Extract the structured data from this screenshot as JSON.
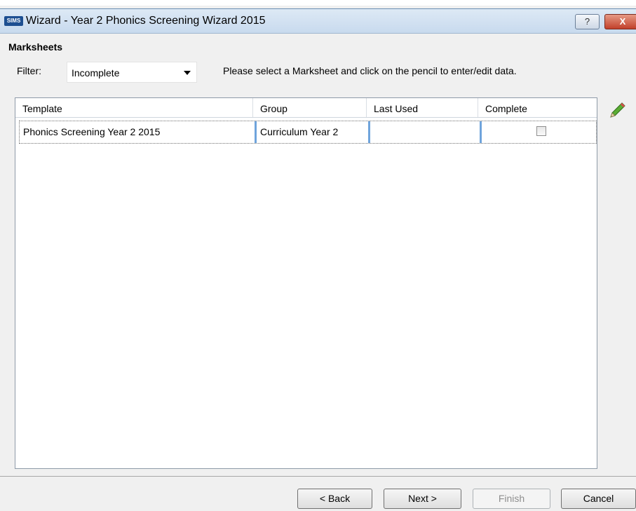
{
  "window": {
    "icon_text": "SIMS",
    "title": "Wizard - Year 2 Phonics Screening Wizard 2015",
    "help_label": "?",
    "close_label": "X"
  },
  "section_title": "Marksheets",
  "filter": {
    "label": "Filter:",
    "value": "Incomplete"
  },
  "instruction": "Please select a Marksheet and click on the pencil to enter/edit data.",
  "grid": {
    "columns": [
      "Template",
      "Group",
      "Last Used",
      "Complete"
    ],
    "rows": [
      {
        "template": "Phonics Screening Year 2 2015",
        "group": "Curriculum Year  2",
        "last_used": "",
        "complete": false
      }
    ]
  },
  "buttons": {
    "back": "< Back",
    "next": "Next >",
    "finish": "Finish",
    "cancel": "Cancel"
  },
  "colors": {
    "pencil": "#4a9a2a",
    "selection_separator": "#6fa4dc"
  }
}
